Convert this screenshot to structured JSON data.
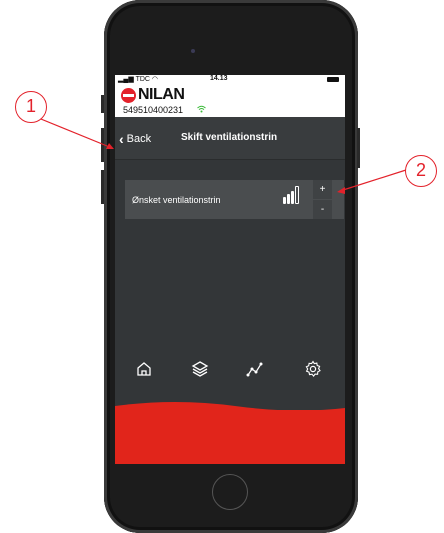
{
  "status": {
    "carrier": "TDC",
    "time": "14.13"
  },
  "brand": {
    "name": "NILAN",
    "device_id": "549510400231"
  },
  "nav": {
    "back_label": "Back",
    "title": "Skift ventilationstrin"
  },
  "setting": {
    "label": "Ønsket ventilationstrin",
    "level": 3,
    "max_level": 4,
    "increase_label": "+",
    "decrease_label": "-"
  },
  "tabs": [
    {
      "icon": "home-icon"
    },
    {
      "icon": "layers-icon"
    },
    {
      "icon": "graph-icon"
    },
    {
      "icon": "settings-gear-icon"
    }
  ],
  "callouts": [
    {
      "number": "1"
    },
    {
      "number": "2"
    }
  ],
  "colors": {
    "brand_red": "#e1251b",
    "app_background": "#333638",
    "card": "#4a4d4f",
    "wifi_green": "#3dbb3a"
  }
}
